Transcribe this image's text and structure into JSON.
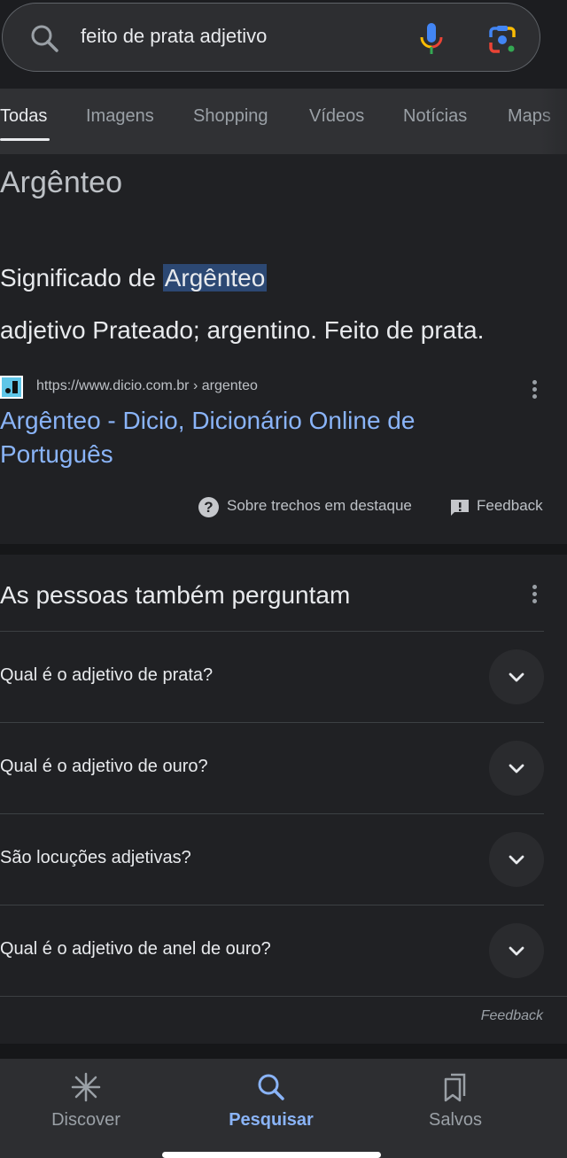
{
  "search": {
    "query": "feito de prata adjetivo",
    "icons": [
      "search-icon",
      "microphone-icon",
      "google-lens-icon"
    ]
  },
  "tabs": [
    {
      "label": "Todas",
      "active": true
    },
    {
      "label": "Imagens",
      "active": false
    },
    {
      "label": "Shopping",
      "active": false
    },
    {
      "label": "Vídeos",
      "active": false
    },
    {
      "label": "Notícias",
      "active": false
    },
    {
      "label": "Maps",
      "active": false
    }
  ],
  "featured_snippet": {
    "title": "Argênteo",
    "meaning_prefix": "Significado de ",
    "meaning_highlight": "Argênteo",
    "definition": "adjetivo Prateado; argentino. Feito de prata.",
    "source_url": "https://www.dicio.com.br › argenteo",
    "result_title": "Argênteo - Dicio, Dicionário Online de Português",
    "about_label": "Sobre trechos em destaque",
    "feedback_label": "Feedback"
  },
  "people_also_ask": {
    "title": "As pessoas também perguntam",
    "questions": [
      "Qual é o adjetivo de prata?",
      "Qual é o adjetivo de ouro?",
      "São locuções adjetivas?",
      "Qual é o adjetivo de anel de ouro?"
    ],
    "feedback_label": "Feedback"
  },
  "bottom_nav": [
    {
      "label": "Discover",
      "icon": "discover-asterisk-icon",
      "active": false
    },
    {
      "label": "Pesquisar",
      "icon": "search-icon",
      "active": true
    },
    {
      "label": "Salvos",
      "icon": "bookmarks-icon",
      "active": false
    }
  ],
  "colors": {
    "background": "#202124",
    "link": "#8ab4f8",
    "highlight": "#2c4873",
    "active_nav": "#8ab4f8"
  }
}
